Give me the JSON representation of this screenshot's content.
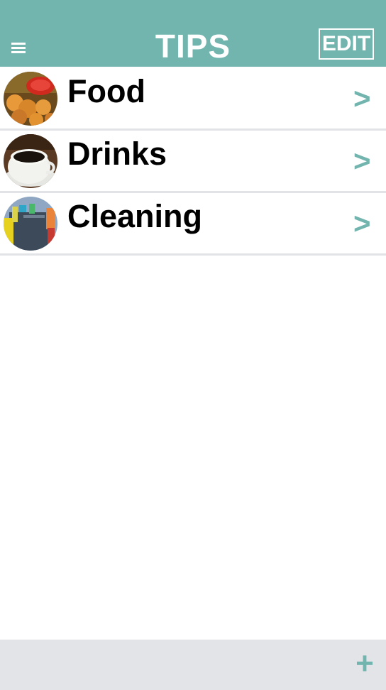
{
  "header": {
    "title": "TIPS",
    "edit_label": "EDIT",
    "menu_icon": "hamburger-menu-icon"
  },
  "categories": [
    {
      "label": "Food",
      "chevron": ">",
      "image": "fried-food-thumbnail"
    },
    {
      "label": "Drinks",
      "chevron": ">",
      "image": "coffee-cup-thumbnail"
    },
    {
      "label": "Cleaning",
      "chevron": ">",
      "image": "cleaning-supplies-thumbnail"
    }
  ],
  "footer": {
    "add_label": "+"
  },
  "colors": {
    "accent": "#72b4ae",
    "footer_bg": "#e3e4e7",
    "divider": "#e2e3e6"
  }
}
